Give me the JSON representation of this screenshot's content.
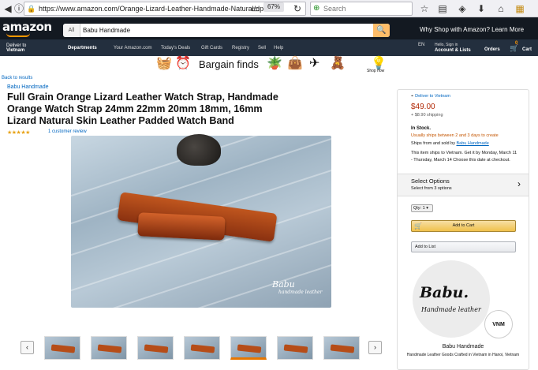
{
  "browser": {
    "url": "https://www.amazon.com/Orange-Lizard-Leather-Handmade-Natural/dp/B0",
    "zoom": "67%",
    "search_placeholder": "Search"
  },
  "amazon_header": {
    "logo": "amazon",
    "search_category": "All",
    "search_query": "Babu Handmade",
    "promo": "Why Shop with Amazon? Learn More",
    "deliver_to": "Deliver to",
    "deliver_location": "Vietnam",
    "nav": {
      "departments": "Departments",
      "your_amazon": "Your Amazon.com",
      "todays_deals": "Today's Deals",
      "gift_cards": "Gift Cards",
      "registry": "Registry",
      "sell": "Sell",
      "help": "Help",
      "lang": "EN",
      "hello": "Hello, Sign in",
      "account": "Account & Lists",
      "orders": "Orders",
      "cart_count": "0",
      "cart": "Cart"
    }
  },
  "banner": {
    "title": "Bargain finds",
    "shop_now": "Shop now"
  },
  "product": {
    "back_link": "Back to results",
    "brand": "Babu Handmade",
    "title": "Full Grain Orange Lizard Leather Watch Strap, Handmade Orange Watch Strap 24mm 22mm 20mm 18mm, 16mm Lizard Natural Skin Leather Padded Watch Band",
    "rating_stars": "★★★★★",
    "reviews": "1 customer review",
    "image_watermark_title": "Babu",
    "image_watermark_sub": "handmade leather"
  },
  "buy_box": {
    "deliver_to": "Deliver to Vietnam",
    "price": "$49.00",
    "shipping": "+ $8.90 shipping",
    "in_stock": "In Stock.",
    "usually_ships": "Usually ships between 2 and 3 days to create",
    "sold_by_prefix": "Ships from and sold by",
    "sold_by": "Babu Handmade",
    "ships_note": "This item ships to Vietnam. Get it by Monday, March 11 - Thursday, March 14 Choose this date at checkout.",
    "options_title": "Select Options",
    "options_sub": "Select from 3 options",
    "qty": "Qty: 1",
    "add_to_cart": "Add to Cart",
    "add_to_list": "Add to List",
    "seller_logo_title": "Babu.",
    "seller_logo_sub": "Handmade leather",
    "seller_badge": "VNM",
    "seller_name": "Babu Handmade",
    "seller_desc": "Handmade Leather Goods Crafted in Vietnam in Hanoi, Vietnam"
  },
  "thumbnails": {
    "count": 7,
    "selected_index": 4
  },
  "colors": {
    "amazon_dark": "#131921",
    "amazon_nav": "#232f3e",
    "accent_orange": "#febd69",
    "price_red": "#b12704",
    "link_blue": "#0066c0"
  }
}
